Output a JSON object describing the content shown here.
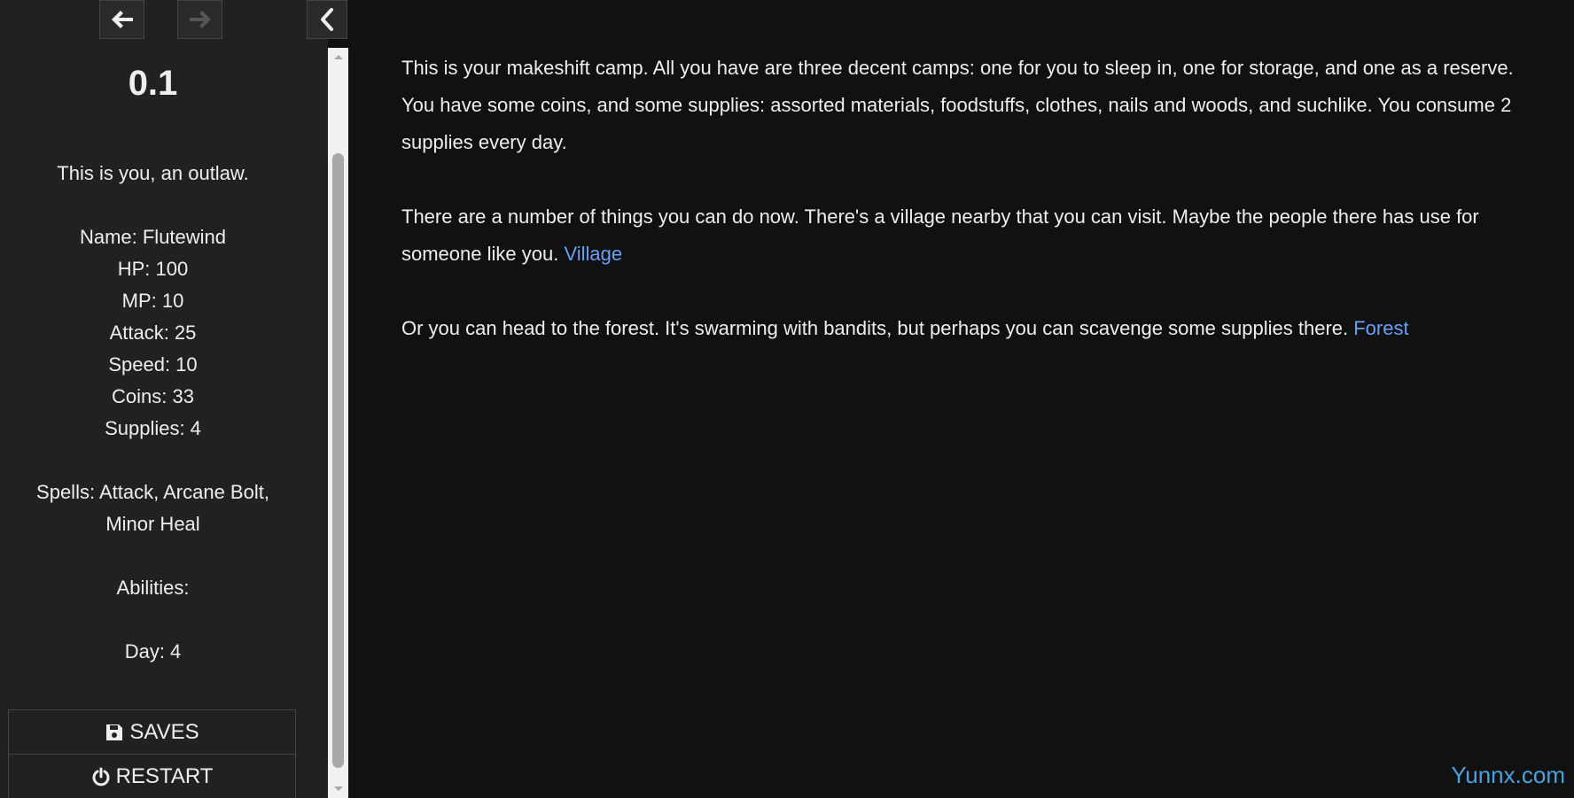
{
  "sidebar": {
    "title": "",
    "version": "0.1",
    "description": "This is you, an outlaw.",
    "stats": {
      "name": "Name: Flutewind",
      "hp": "HP: 100",
      "mp": "MP: 10",
      "attack": "Attack: 25",
      "speed": "Speed: 10",
      "coins": "Coins: 33",
      "supplies": "Supplies: 4"
    },
    "spells": "Spells: Attack, Arcane Bolt, Minor Heal",
    "abilities": "Abilities:",
    "day": "Day: 4"
  },
  "menu": {
    "saves_label": "SAVES",
    "restart_label": "RESTART"
  },
  "passage": {
    "p1": "This is your makeshift camp. All you have are three decent camps: one for you to sleep in, one for storage, and one as a reserve. You have some coins, and some supplies: assorted materials, foodstuffs, clothes, nails and woods, and suchlike. You consume 2 supplies every day.",
    "p2": "There are a number of things you can do now. There's a village nearby that you can visit. Maybe the people there has use for someone like you. ",
    "p2_link": "Village",
    "p3": "Or you can head to the forest. It's swarming with bandits, but perhaps you can scavenge some supplies there. ",
    "p3_link": "Forest"
  },
  "watermark": "Yunnx.com",
  "colors": {
    "background": "#111111",
    "sidebar": "#212121",
    "link": "#68a0f7",
    "watermark": "#4aa3df"
  },
  "icons": [
    "arrow-left-icon",
    "arrow-right-icon",
    "chevron-left-icon",
    "floppy-disk-icon",
    "power-icon",
    "scroll-up-icon",
    "scroll-down-icon"
  ]
}
